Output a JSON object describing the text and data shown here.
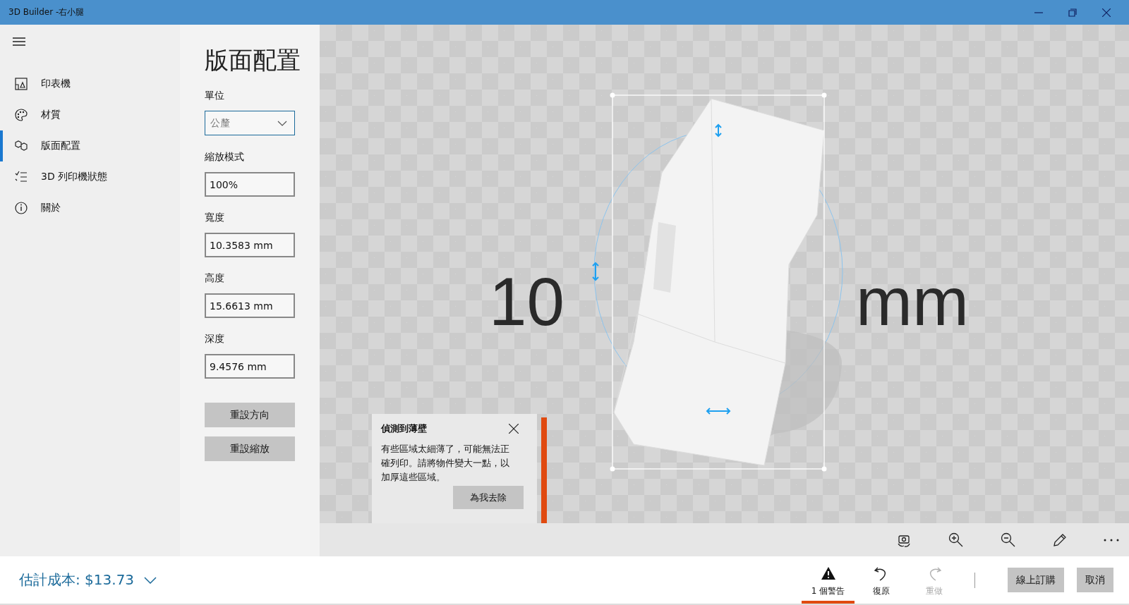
{
  "window": {
    "title": "3D Builder -右小腿"
  },
  "sidebar": {
    "items": [
      {
        "label": "印表機",
        "selected": false
      },
      {
        "label": "材質",
        "selected": false
      },
      {
        "label": "版面配置",
        "selected": true
      },
      {
        "label": "3D 列印機狀態",
        "selected": false
      },
      {
        "label": "關於",
        "selected": false
      }
    ]
  },
  "panel": {
    "title": "版面配置",
    "unit": {
      "label": "單位",
      "value": "公釐"
    },
    "fields": [
      {
        "label": "縮放模式",
        "value": "100%"
      },
      {
        "label": "寬度",
        "value": "10.3583 mm"
      },
      {
        "label": "高度",
        "value": "15.6613 mm"
      },
      {
        "label": "深度",
        "value": "9.4576 mm"
      }
    ],
    "buttons": [
      "重設方向",
      "重設縮放"
    ]
  },
  "viewport": {
    "scale_text": [
      "10",
      "mm"
    ]
  },
  "warning_popup": {
    "title": "偵測到薄壁",
    "message": "有些區域太細薄了，可能無法正確列印。請將物件變大一點，以加厚這些區域。",
    "button": "為我去除"
  },
  "footer": {
    "cost": "估計成本: $13.73",
    "actions": [
      {
        "label": "1 個警告",
        "selected": true,
        "disabled": false
      },
      {
        "label": "復原",
        "selected": false,
        "disabled": false
      },
      {
        "label": "重做",
        "selected": false,
        "disabled": true
      }
    ],
    "buttons": [
      "線上訂購",
      "取消"
    ]
  }
}
